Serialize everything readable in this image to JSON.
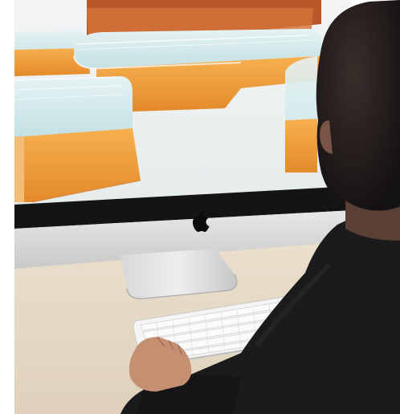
{
  "scene": {
    "description_items": {
      "brand_logo": "apple-logo",
      "objects": [
        "imac-display",
        "aluminum-stand",
        "wireless-keyboard",
        "desk",
        "person-with-hand-on-keyboard"
      ]
    },
    "colors": {
      "background": "#ffffff",
      "desk": "#e4d7c4",
      "monitor_silver": "#d9d9d8",
      "monitor_bezel": "#141414",
      "screen_orange": "#f0a041",
      "screen_glass": "#cfe6e8",
      "person_dark": "#1b1b1d",
      "skin": "#c58f72",
      "keyboard": "#f1f1f1"
    }
  }
}
